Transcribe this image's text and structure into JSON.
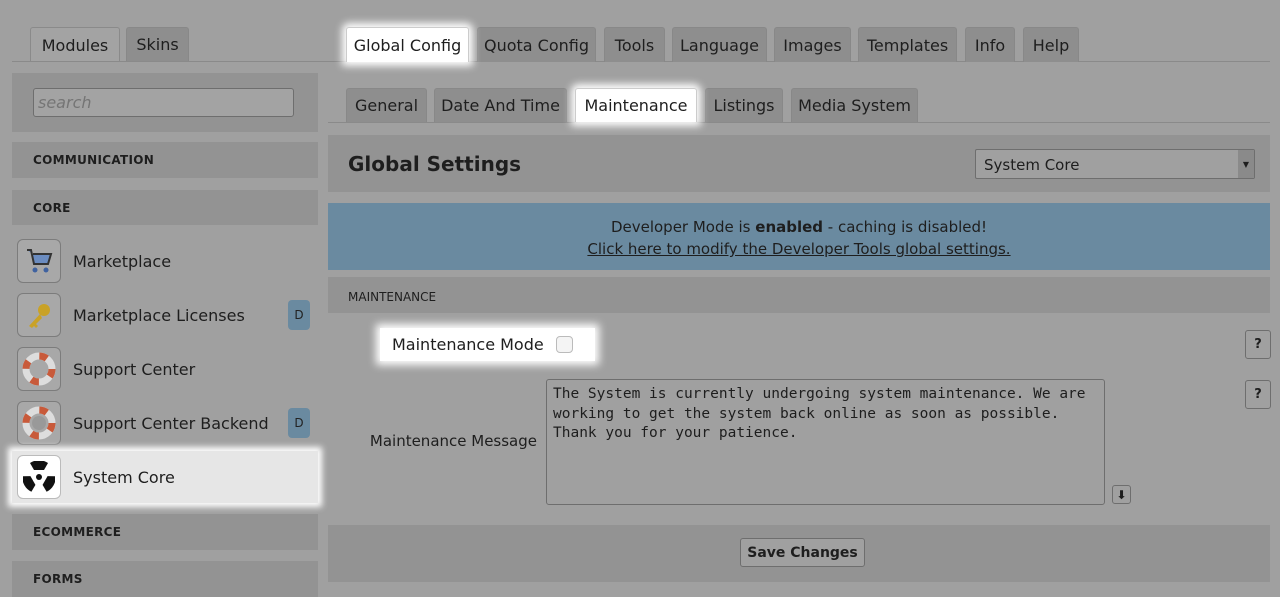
{
  "sidebar": {
    "tabs": [
      "Modules",
      "Skins"
    ],
    "search_placeholder": "search",
    "sections": {
      "communication": "COMMUNICATION",
      "core": "CORE",
      "ecommerce": "ECOMMERCE",
      "forms": "FORMS"
    },
    "items": [
      {
        "label": "Marketplace",
        "icon": "cart-icon",
        "badge": null
      },
      {
        "label": "Marketplace Licenses",
        "icon": "key-icon",
        "badge": "D"
      },
      {
        "label": "Support Center",
        "icon": "lifebuoy-icon",
        "badge": null
      },
      {
        "label": "Support Center Backend",
        "icon": "lifebuoy-gear-icon",
        "badge": "D"
      },
      {
        "label": "System Core",
        "icon": "radiation-icon",
        "badge": null
      }
    ]
  },
  "main_tabs": [
    "Global Config",
    "Quota Config",
    "Tools",
    "Language",
    "Images",
    "Templates",
    "Info",
    "Help"
  ],
  "sub_tabs": [
    "General",
    "Date And Time",
    "Maintenance",
    "Listings",
    "Media System"
  ],
  "header": {
    "title": "Global Settings",
    "select_value": "System Core"
  },
  "banner": {
    "prefix": "Developer Mode is ",
    "bold": "enabled",
    "suffix": " - caching is disabled!",
    "link": "Click here to modify the Developer Tools global settings.",
    "color": "#6a8aa0"
  },
  "section_title": "MAINTENANCE",
  "fields": {
    "mode_label": "Maintenance Mode",
    "mode_checked": false,
    "message_label": "Maintenance Message",
    "message_value": "The System is currently undergoing system maintenance. We are working to get the system back online as soon as possible. Thank you for your patience.",
    "help": "?"
  },
  "save_label": "Save Changes"
}
